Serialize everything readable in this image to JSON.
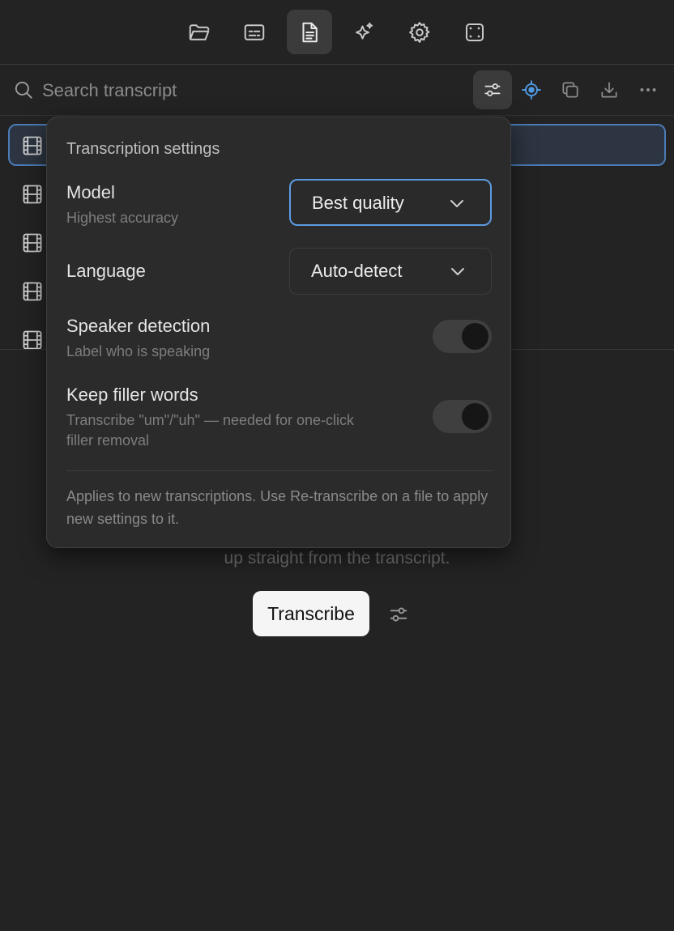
{
  "topbar": {
    "icons": [
      "folder-icon",
      "captions-icon",
      "transcript-document-icon",
      "sparkles-icon",
      "gear-icon",
      "frame-icon"
    ],
    "active_icon": "transcript-document-icon"
  },
  "search": {
    "placeholder": "Search transcript"
  },
  "toolbar": {
    "icons": [
      "settings-sliders-icon",
      "target-icon",
      "copy-icon",
      "download-icon",
      "more-icon"
    ],
    "accent_color": "#4f9ae3"
  },
  "file_list": {
    "row_icon": "film-icon",
    "selected_index": 0
  },
  "settings_popover": {
    "title": "Transcription settings",
    "model": {
      "label": "Model",
      "sublabel": "Highest accuracy",
      "value": "Best quality"
    },
    "language": {
      "label": "Language",
      "value": "Auto-detect"
    },
    "speaker_detection": {
      "label": "Speaker detection",
      "sublabel": "Label who is speaking",
      "enabled": false
    },
    "keep_filler_words": {
      "label": "Keep filler words",
      "sublabel_line1": "Transcribe \"um\"/\"uh\" — needed for one-click",
      "sublabel_line2": "filler removal",
      "enabled": false
    },
    "footer_note": "Applies to new transcriptions. Use Re-transcribe on a file to apply new settings to it."
  },
  "empty_state": {
    "text": "up straight from the transcript.",
    "transcribe_label": "Transcribe"
  }
}
